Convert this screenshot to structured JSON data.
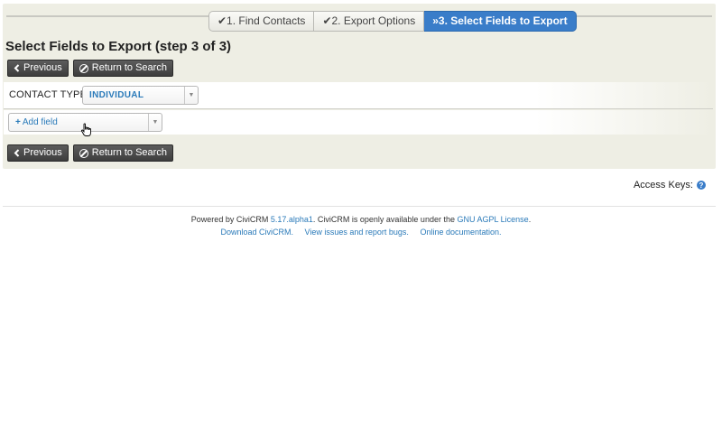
{
  "wizard": {
    "steps": [
      {
        "label": "✔1. Find Contacts"
      },
      {
        "label": "✔2. Export Options"
      },
      {
        "label": "»3. Select Fields to Export"
      }
    ]
  },
  "page": {
    "title": "Select Fields to Export (step 3 of 3)"
  },
  "buttons": {
    "previous": "Previous",
    "return_search": "Return to Search"
  },
  "contact_type": {
    "label": "CONTACT TYPE",
    "value": "INDIVIDUAL"
  },
  "add_field": {
    "label": "Add field"
  },
  "access_keys": {
    "label": "Access Keys:"
  },
  "footer": {
    "powered_by": "Powered by CiviCRM",
    "version": "5.17.alpha1",
    "license_text": ". CiviCRM is openly available under the",
    "license_link": "GNU AGPL License",
    "period": ".",
    "links": [
      "Download CiviCRM.",
      "View issues and report bugs.",
      "Online documentation."
    ]
  },
  "colors": {
    "accent": "#3a7dc9",
    "link": "#2a7ab9",
    "panel": "#eeeee4",
    "button": "#4a4a4a"
  }
}
